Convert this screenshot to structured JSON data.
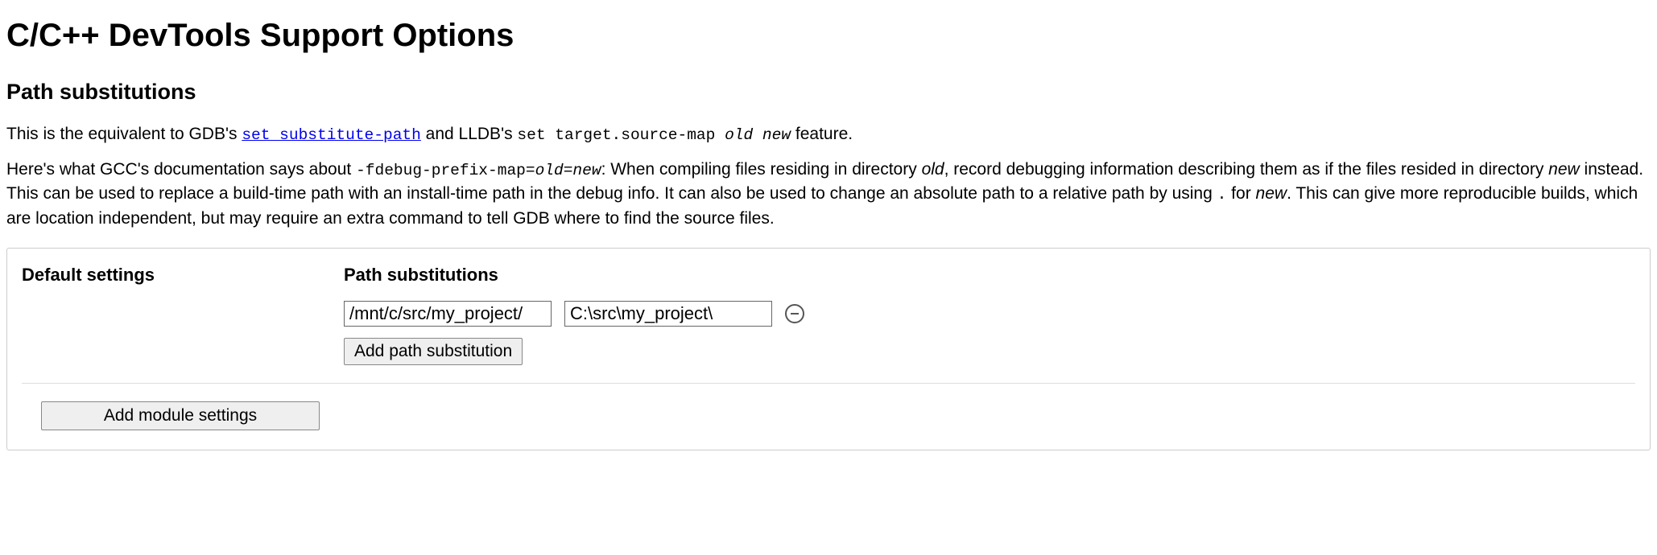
{
  "header": {
    "title": "C/C++ DevTools Support Options"
  },
  "section": {
    "title": "Path substitutions"
  },
  "para1": {
    "pre": "This is the equivalent to GDB's ",
    "link": "set substitute-path",
    "mid": " and LLDB's ",
    "code": "set target.source-map ",
    "code_ital": "old new",
    "post": " feature."
  },
  "para2": {
    "a": "Here's what GCC's documentation says about ",
    "code1": "-fdebug-prefix-map=",
    "code1_ital": "old=new",
    "b": ": When compiling files residing in directory ",
    "ital_old": "old",
    "c": ", record debugging information describing them as if the files resided in directory ",
    "ital_new": "new",
    "d": " instead. This can be used to replace a build-time path with an install-time path in the debug info. It can also be used to change an absolute path to a relative path by using ",
    "code_dot": ".",
    "e": " for ",
    "ital_new2": "new",
    "f": ". This can give more reproducible builds, which are location independent, but may require an extra command to tell GDB where to find the source files."
  },
  "box": {
    "default_label": "Default settings",
    "sub_label": "Path substitutions",
    "path_from": "/mnt/c/src/my_project/",
    "path_to": "C:\\src\\my_project\\",
    "add_sub_button": "Add path substitution",
    "add_module_button": "Add module settings"
  }
}
